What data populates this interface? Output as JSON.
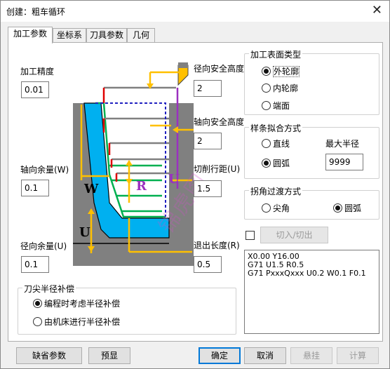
{
  "window": {
    "title": "创建：粗车循环",
    "close_glyph": "✕"
  },
  "tabs": [
    "加工参数",
    "坐标系",
    "刀具参数",
    "几何"
  ],
  "left": {
    "precision_label": "加工精度",
    "precision_value": "0.01",
    "axial_allowance_label": "轴向余量(W)",
    "axial_allowance_value": "0.1",
    "radial_allowance_label": "径向余量(U)",
    "radial_allowance_value": "0.1"
  },
  "center": {
    "radial_safe_height_label": "径向安全高度",
    "radial_safe_height_value": "2",
    "axial_safe_height_label": "轴向安全高度",
    "axial_safe_height_value": "2",
    "cut_step_label": "切削行距(U)",
    "cut_step_value": "1.5",
    "retract_length_label": "退出长度(R)",
    "retract_length_value": "0.5"
  },
  "diagram": {
    "letter_w": "W",
    "letter_r": "R",
    "letter_u_right": "U",
    "letter_u_bottom": "U",
    "watermark": "锦虎图"
  },
  "surface_type": {
    "title": "加工表面类型",
    "options": [
      "外轮廓",
      "内轮廓",
      "端面"
    ],
    "selected": 0
  },
  "spline_fit": {
    "title": "样条拟合方式",
    "options": [
      "直线",
      "圆弧"
    ],
    "selected": 1,
    "max_radius_label": "最大半径",
    "max_radius_value": "9999"
  },
  "corner_transition": {
    "title": "拐角过渡方式",
    "options": [
      "尖角",
      "圆弧"
    ],
    "selected": 1
  },
  "cut_in_out": {
    "checked": false,
    "button_label": "切入/切出"
  },
  "gcode": [
    "X0.00 Y16.00",
    "G71 U1.5 R0.5",
    "G71 PxxxQxxx U0.2 W0.1 F0.1"
  ],
  "tool_comp": {
    "title": "刀尖半径补偿",
    "options": [
      "编程时考虑半径补偿",
      "由机床进行半径补偿"
    ],
    "selected": 0
  },
  "buttons": {
    "defaults": "缺省参数",
    "preview": "预显",
    "ok": "确定",
    "cancel": "取消",
    "suspend": "悬挂",
    "compute": "计算"
  },
  "colors": {
    "gray_stock": "#808080",
    "blue_part": "#00b0f0",
    "green_path": "#00b050",
    "red": "#e00000",
    "purple": "#9b30c0",
    "orange": "#ffc000",
    "dashed_blue": "#2020c0",
    "default_button_border": "#0078d7"
  }
}
